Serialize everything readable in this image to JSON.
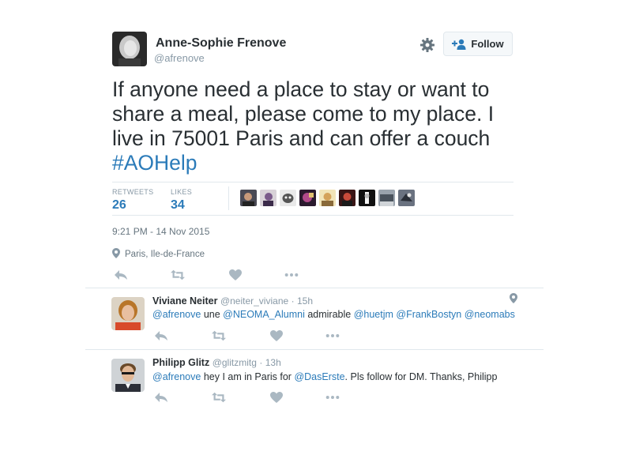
{
  "tweet": {
    "author": {
      "name": "Anne-Sophie Frenove",
      "handle": "@afrenove"
    },
    "follow_label": "Follow",
    "text_lines": [
      "If anyone need a place to stay or want to",
      "share a meal, please come to my place.  I",
      "live in 75001 Paris and can offer a couch"
    ],
    "hashtag": "#AOHelp",
    "stats": {
      "retweets_label": "RETWEETS",
      "retweets": "26",
      "likes_label": "LIKES",
      "likes": "34"
    },
    "timestamp": "9:21 PM - 14 Nov 2015",
    "location": "Paris, Ile-de-France"
  },
  "replies": [
    {
      "name": "Viviane Neiter",
      "handle": "@neiter_viviane",
      "time": "· 15h",
      "segments": [
        {
          "text": "@afrenove",
          "mention": true
        },
        {
          "text": " une ",
          "mention": false
        },
        {
          "text": "@NEOMA_Alumni",
          "mention": true
        },
        {
          "text": " admirable ",
          "mention": false
        },
        {
          "text": "@huetjm",
          "mention": true
        },
        {
          "text": " ",
          "mention": false
        },
        {
          "text": "@FrankBostyn",
          "mention": true
        },
        {
          "text": " ",
          "mention": false
        },
        {
          "text": "@neomabs",
          "mention": true
        }
      ]
    },
    {
      "name": "Philipp Glitz",
      "handle": "@glitzmitg",
      "time": "· 13h",
      "segments": [
        {
          "text": "@afrenove",
          "mention": true
        },
        {
          "text": " hey I am in Paris for ",
          "mention": false
        },
        {
          "text": "@DasErste",
          "mention": true
        },
        {
          "text": ". Pls follow for DM. Thanks, Philipp",
          "mention": false
        }
      ]
    }
  ],
  "icons": {
    "reply": "reply-icon",
    "retweet": "retweet-icon",
    "like": "heart-icon",
    "more": "more-icon",
    "gear": "gear-icon",
    "location": "location-pin-icon"
  },
  "colors": {
    "link": "#2b7bb9",
    "muted": "#8899a6",
    "text": "#292f33",
    "icon": "#aab8c2",
    "divider": "#e1e8ed"
  }
}
